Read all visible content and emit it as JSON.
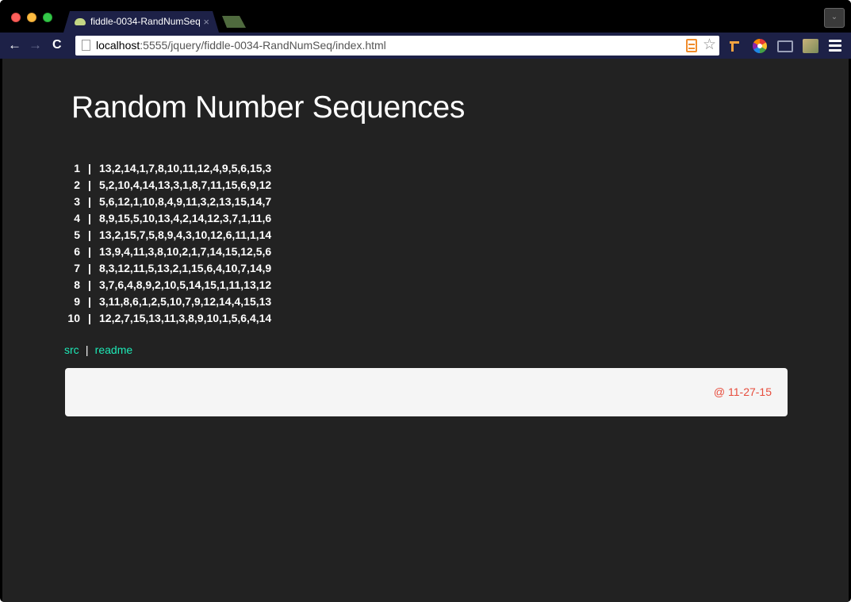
{
  "browser": {
    "tab_title": "fiddle-0034-RandNumSeq",
    "tab_close": "×",
    "url_host": "localhost",
    "url_path": ":5555/jquery/fiddle-0034-RandNumSeq/index.html",
    "back_icon": "arrow-left-icon",
    "forward_icon": "arrow-right-icon",
    "reload_icon": "reload-icon",
    "bookmark_icon": "star-icon",
    "menu_icon": "hamburger-menu-icon"
  },
  "page": {
    "title": "Random Number Sequences",
    "sequences": [
      {
        "num": "1",
        "sep": "|",
        "values": "13,2,14,1,7,8,10,11,12,4,9,5,6,15,3"
      },
      {
        "num": "2",
        "sep": "|",
        "values": "5,2,10,4,14,13,3,1,8,7,11,15,6,9,12"
      },
      {
        "num": "3",
        "sep": "|",
        "values": "5,6,12,1,10,8,4,9,11,3,2,13,15,14,7"
      },
      {
        "num": "4",
        "sep": "|",
        "values": "8,9,15,5,10,13,4,2,14,12,3,7,1,11,6"
      },
      {
        "num": "5",
        "sep": "|",
        "values": "13,2,15,7,5,8,9,4,3,10,12,6,11,1,14"
      },
      {
        "num": "6",
        "sep": "|",
        "values": "13,9,4,11,3,8,10,2,1,7,14,15,12,5,6"
      },
      {
        "num": "7",
        "sep": "|",
        "values": "8,3,12,11,5,13,2,1,15,6,4,10,7,14,9"
      },
      {
        "num": "8",
        "sep": "|",
        "values": "3,7,6,4,8,9,2,10,5,14,15,1,11,13,12"
      },
      {
        "num": "9",
        "sep": "|",
        "values": "3,11,8,6,1,2,5,10,7,9,12,14,4,15,13"
      },
      {
        "num": "10",
        "sep": "|",
        "values": "12,2,7,15,13,11,3,8,9,10,1,5,6,4,14"
      }
    ],
    "links": {
      "src": "src",
      "sep": "|",
      "readme": "readme"
    },
    "footer_date": "@ 11-27-15"
  },
  "colors": {
    "link": "#1de9b6",
    "date": "#e74c3c",
    "page_bg": "#222222",
    "toolbar_bg": "#1d2147"
  }
}
